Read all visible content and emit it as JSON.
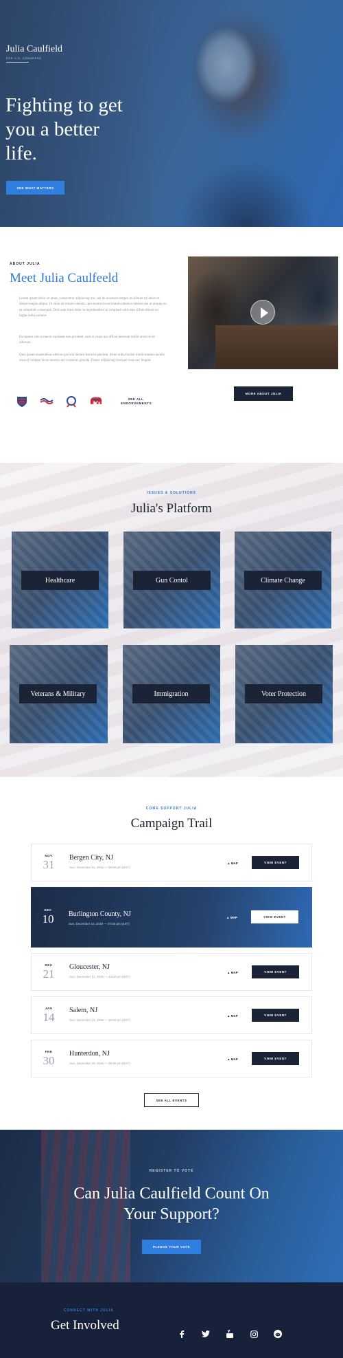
{
  "hero": {
    "brand_name": "Julia Caulfield",
    "brand_sub": "FOR U.S. CONGRESS",
    "title": "Fighting to get you a better life.",
    "button": "SEE WHAT MATTERS"
  },
  "about": {
    "kicker": "ABOUT JULIA",
    "title": "Meet Julia Caulfeeld",
    "p1": "Lorem ipsum dolor sit amet, consectetur adipiscing elit, sed do eiusmod tempor incididunt ut labore et dolore magna aliqua. Ut enim ad minim veniam, quis nostrud exercitation ullamco laboris nisi ut aliquip ex ea commodo consequat. Duis aute irure dolor in reprehenderit in voluptate velit esse cillum dolore eu fugiat nulla pariatur.",
    "p2": "Excepteur sint occaecat cupidatat non proident, sunt in culpa qui officia deserunt mollit anim id est laborum.",
    "p3": "Quis ipsum suspendisse ultrices gravida dictum fusce ut placerat. Amet nulla facilisi morbi tempus iaculis urna id volutpat lacus laoreet non curabitur gravida. Donec adipiscing tristique risus nec feugiat.",
    "endorse": "SEE ALL ENDORSEMENTS",
    "more_button": "MORE ABOUT JULIA"
  },
  "platform": {
    "kicker": "ISSUES & SOLUTIONS",
    "title": "Julia's Platform",
    "cards": [
      "Healthcare",
      "Gun Contol",
      "Climate Change",
      "Veterans & Military",
      "Immigration",
      "Voter Protection"
    ]
  },
  "trail": {
    "kicker": "COME SUPPORT JULIA",
    "title": "Campaign Trail",
    "map_label": "MAP",
    "view_label": "VIEW EVENT",
    "all_button": "SEE ALL EVENTS",
    "events": [
      {
        "month": "NOV",
        "day": "31",
        "name": "Bergen City, NJ",
        "date": "Sun, November 31, 2016 — 00:00 pm (EST)"
      },
      {
        "month": "DEC",
        "day": "10",
        "name": "Burlington County, NJ",
        "date": "Sun, December 10, 2016 — 07:00 pm (EST)"
      },
      {
        "month": "DEC",
        "day": "21",
        "name": "Gloucester, NJ",
        "date": "Sun, December 21, 2016 — 10:00 pm (EST)"
      },
      {
        "month": "JAN",
        "day": "14",
        "name": "Salem, NJ",
        "date": "Sun, December 14, 2016 — 06:00 pm (EST)"
      },
      {
        "month": "FEB",
        "day": "30",
        "name": "Hunterdon, NJ",
        "date": "Sun, December 30, 2016 — 08:00 pm (EST)"
      }
    ]
  },
  "register": {
    "kicker": "REGISTER TO VOTE",
    "title": "Can Julia Caulfield Count On Your Support?",
    "button": "PLEDGE YOUR VOTE"
  },
  "footer": {
    "kicker": "CONNECT WITH JULIA",
    "title": "Get Involved",
    "socials": [
      "facebook-icon",
      "twitter-icon",
      "youtube-icon",
      "instagram-icon",
      "reddit-icon"
    ]
  },
  "colors": {
    "accent": "#2f7ee0",
    "navy": "#1b2436",
    "headline_blue": "#2e7ad6"
  }
}
